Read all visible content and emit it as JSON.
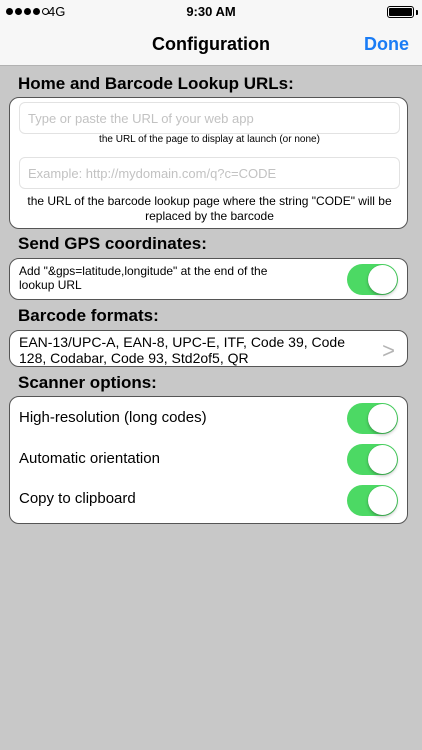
{
  "status_bar": {
    "carrier": "4G",
    "time": "9:30 AM"
  },
  "nav": {
    "title": "Configuration",
    "done_label": "Done"
  },
  "sections": {
    "urls": {
      "header": "Home and Barcode Lookup URLs:",
      "home_placeholder": "Type or paste the URL of your web app",
      "home_value": "",
      "home_hint": "the URL of the page to display at launch (or none)",
      "lookup_placeholder": "Example: http://mydomain.com/q?c=CODE",
      "lookup_value": "",
      "lookup_hint": "the URL of the barcode lookup page where the string \"CODE\" will be replaced by the barcode"
    },
    "gps": {
      "header": "Send GPS coordinates:",
      "description": "Add \"&gps=latitude,longitude\" at the end of the lookup URL",
      "enabled": true
    },
    "formats": {
      "header": "Barcode formats:",
      "value": "EAN-13/UPC-A, EAN-8, UPC-E, ITF, Code 39, Code 128, Codabar, Code 93, Std2of5, QR",
      "chevron": ">"
    },
    "scanner": {
      "header": "Scanner options:",
      "options": [
        {
          "label": "High-resolution (long codes)",
          "enabled": true
        },
        {
          "label": "Automatic orientation",
          "enabled": true
        },
        {
          "label": "Copy to clipboard",
          "enabled": true
        }
      ]
    }
  },
  "colors": {
    "accent": "#1a7cf5",
    "toggle_on": "#4cd964",
    "background": "#c8c8c8"
  }
}
